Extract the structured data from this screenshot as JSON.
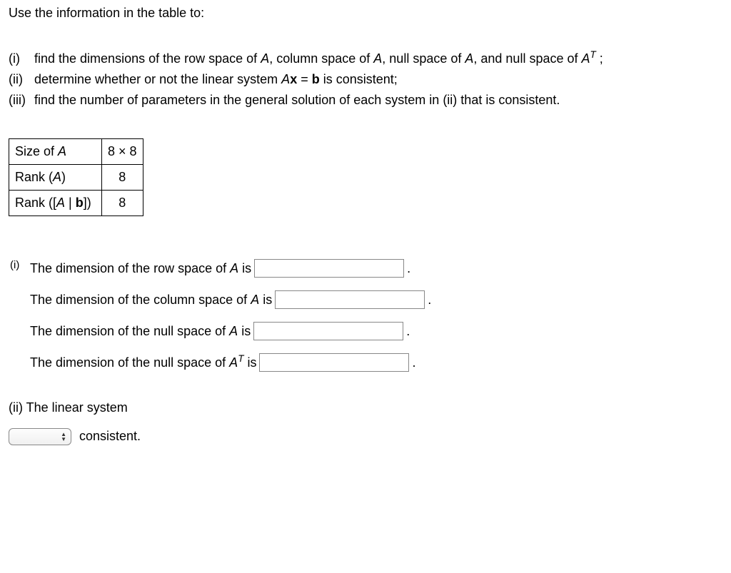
{
  "intro": "Use the information in the table to:",
  "problems": {
    "i": {
      "num": "(i)",
      "text_before": "find the dimensions of the row space of ",
      "A": "A",
      "text_mid1": ", column space of ",
      "text_mid2": ", null space of ",
      "text_mid3": ", and null space of ",
      "AT_base": "A",
      "AT_sup": "T",
      "text_after": " ;"
    },
    "ii": {
      "num": "(ii)",
      "text_before": "determine whether or not the linear system ",
      "Ax": "A",
      "x": "x",
      "eq": " = ",
      "b": "b",
      "text_after": " is consistent;"
    },
    "iii": {
      "num": "(iii)",
      "text": "find the number of parameters in the general solution of each system in (ii) that is consistent."
    }
  },
  "table": {
    "row1": {
      "label_before": "Size of ",
      "label_ital": "A",
      "value": "8 × 8"
    },
    "row2": {
      "label_before": "Rank (",
      "label_ital": "A",
      "label_after": ")",
      "value": "8"
    },
    "row3": {
      "label_before": "Rank ([",
      "label_ital1": "A",
      "label_mid": " | ",
      "label_bold": "b",
      "label_after": "])",
      "value": "8"
    }
  },
  "answers_i": {
    "lead": "(i)",
    "row1": {
      "before": "The dimension of the row space of ",
      "ital": "A",
      "after": " is"
    },
    "row2": {
      "before": "The dimension of the column space of ",
      "ital": "A",
      "after": " is"
    },
    "row3": {
      "before": "The dimension of the null space of ",
      "ital": "A",
      "after": " is"
    },
    "row4": {
      "before": "The dimension of the null space of ",
      "ital": "A",
      "sup": "T",
      "after": " is"
    }
  },
  "answers_ii": {
    "lead": "(ii) The linear system",
    "tail": "consistent."
  },
  "period": "."
}
